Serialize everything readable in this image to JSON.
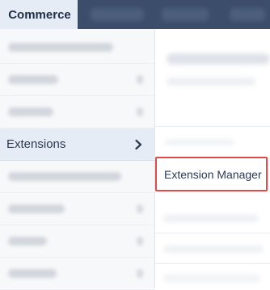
{
  "topbar": {
    "active_tab": "Commerce"
  },
  "menu": {
    "active_item": {
      "label": "Extensions",
      "chevron_icon": "chevron-right-icon"
    }
  },
  "submenu": {
    "highlighted_item": "Extension Manager",
    "highlight_color": "#e04a4a"
  },
  "colors": {
    "topbar": "#3b4d6a",
    "active_bg": "#e6ecf5",
    "text": "#2b3a50"
  }
}
